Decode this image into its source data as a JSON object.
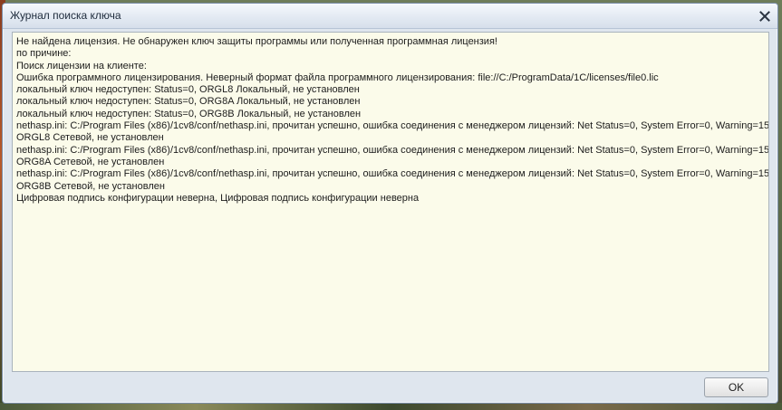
{
  "window": {
    "title": "Журнал поиска ключа"
  },
  "icons": {
    "close": "close-icon"
  },
  "log": {
    "lines": [
      "Не найдена лицензия. Не обнаружен ключ защиты программы или полученная программная лицензия!",
      "по причине:",
      "Поиск лицензии на клиенте:",
      "Ошибка программного лицензирования. Неверный формат файла программного лицензирования: file://C:/ProgramData/1C/licenses/file0.lic",
      "локальный ключ недоступен: Status=0, ORGL8 Локальный, не установлен",
      "локальный ключ недоступен: Status=0, ORG8A Локальный, не установлен",
      "локальный ключ недоступен: Status=0, ORG8B Локальный, не установлен",
      "nethasp.ini: C:/Program Files (x86)/1cv8/conf/nethasp.ini, прочитан успешно, ошибка соединения с менеджером лицензий: Net Status=0, System Error=0, Warning=15,",
      "ORGL8 Сетевой, не установлен",
      "nethasp.ini: C:/Program Files (x86)/1cv8/conf/nethasp.ini, прочитан успешно, ошибка соединения с менеджером лицензий: Net Status=0, System Error=0, Warning=15,",
      "ORG8A Сетевой, не установлен",
      "nethasp.ini: C:/Program Files (x86)/1cv8/conf/nethasp.ini, прочитан успешно, ошибка соединения с менеджером лицензий: Net Status=0, System Error=0, Warning=15,",
      "ORG8B Сетевой, не установлен",
      "Цифровая подпись конфигурации неверна, Цифровая подпись конфигурации неверна"
    ]
  },
  "buttons": {
    "ok_label": "OK"
  }
}
